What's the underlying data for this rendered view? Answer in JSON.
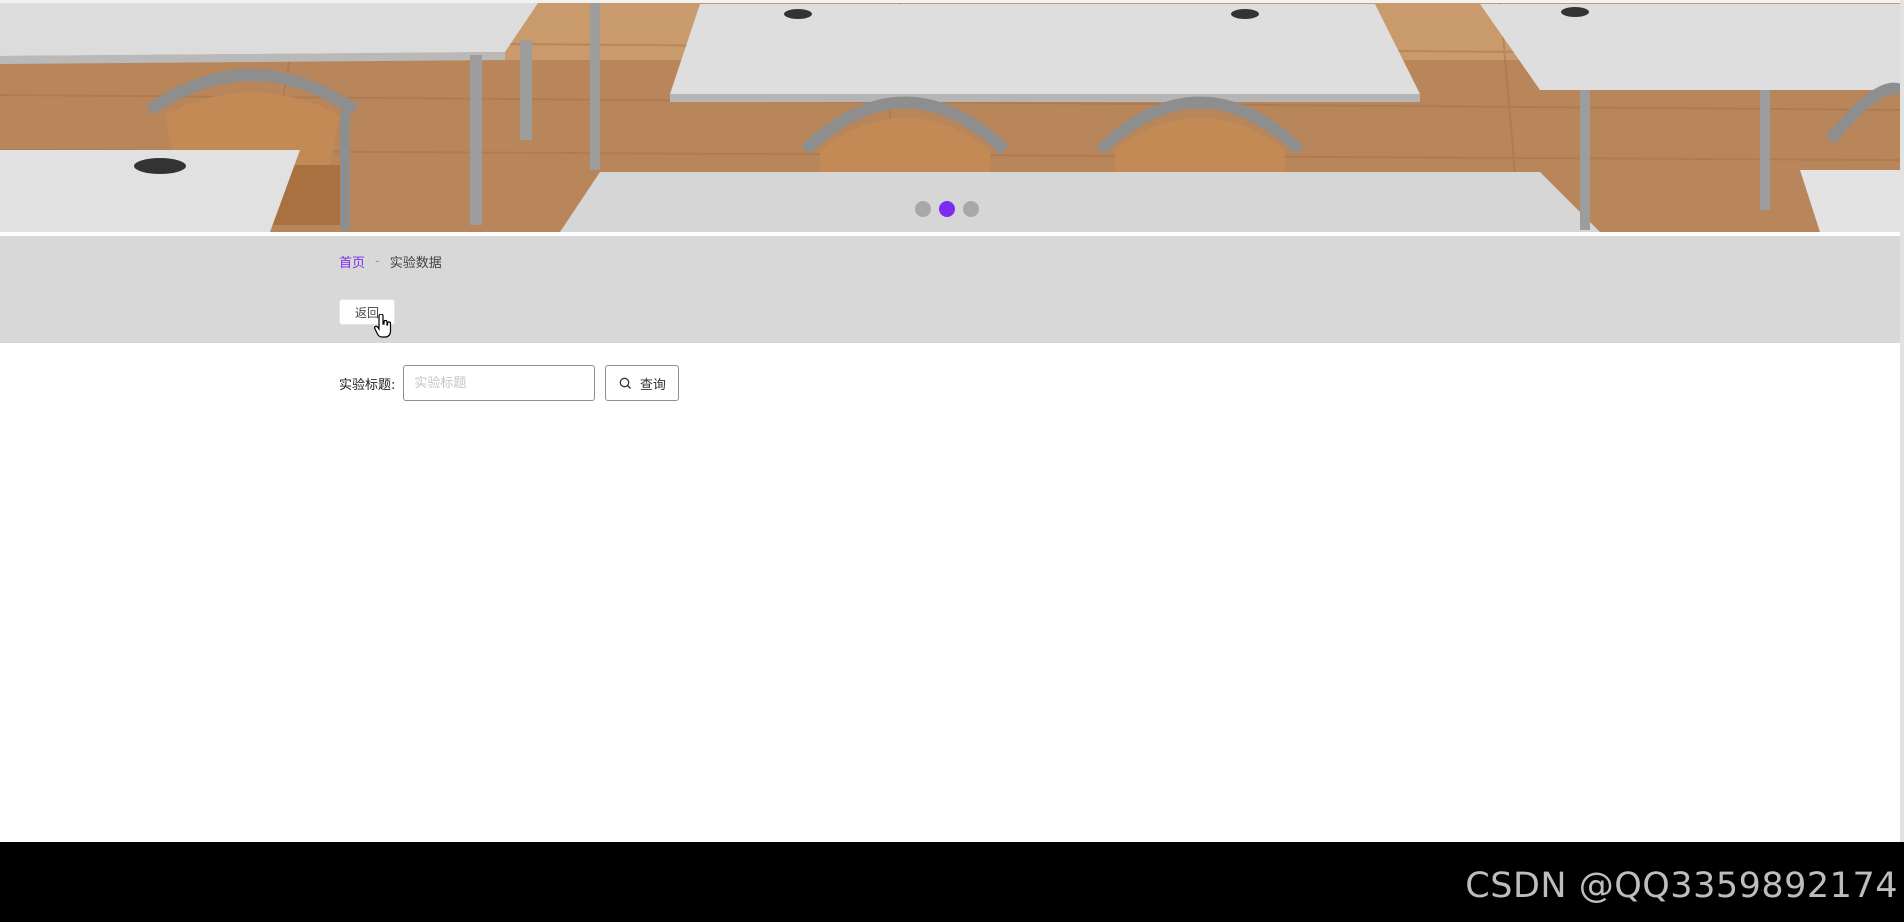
{
  "carousel": {
    "slide_count": 3,
    "active_index": 1,
    "colors": {
      "active_dot": "#7b2cf0",
      "inactive_dot": "#a8a8a8"
    }
  },
  "breadcrumb": {
    "home": "首页",
    "separator": "-",
    "current": "实验数据"
  },
  "header": {
    "back_label": "返回"
  },
  "search": {
    "label": "实验标题:",
    "placeholder": "实验标题",
    "value": "",
    "button_label": "查询",
    "button_icon": "search-icon"
  },
  "footer": {
    "watermark": "CSDN @QQ3359892174"
  },
  "colors": {
    "accent": "#7b2cf0",
    "strip_bg": "#d8d8d8",
    "footer_bg": "#000000"
  }
}
